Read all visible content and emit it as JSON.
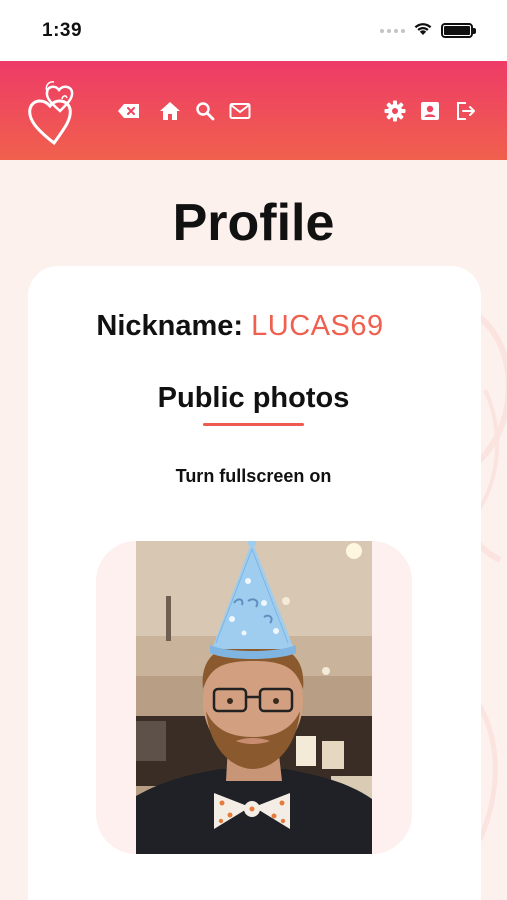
{
  "status_bar": {
    "time": "1:39",
    "icons": [
      "signal-dots-icon",
      "wifi-icon",
      "battery-icon"
    ]
  },
  "header": {
    "logo": "hearts-logo",
    "left_icons": [
      "backspace-icon",
      "home-icon",
      "search-icon",
      "mail-icon"
    ],
    "right_icons": [
      "settings-icon",
      "contact-card-icon",
      "logout-icon"
    ],
    "gradient_colors": [
      "#ee3b67",
      "#f0604d"
    ]
  },
  "page": {
    "title": "Profile"
  },
  "profile": {
    "nickname_label": "Nickname:",
    "nickname_value": "LUCAS69",
    "public_photos_title": "Public photos",
    "fullscreen_toggle_label": "Turn fullscreen on"
  },
  "photo": {
    "subject": "photo-of-man-in-blue-party-hat"
  },
  "colors": {
    "accent": "#ef6050",
    "background": "#fdf1ee",
    "card": "#ffffff"
  }
}
